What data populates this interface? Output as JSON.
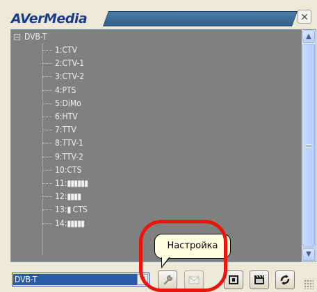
{
  "app": {
    "logo": "AVerMedia"
  },
  "titlebar": {
    "close_label": "×"
  },
  "tree": {
    "root_label": "DVB-T",
    "channels": [
      {
        "label": "1:CTV"
      },
      {
        "label": "2:CTV-1"
      },
      {
        "label": "3:CTV-2"
      },
      {
        "label": "4:PTS"
      },
      {
        "label": "5:DiMo"
      },
      {
        "label": "6:HTV"
      },
      {
        "label": "7:TTV"
      },
      {
        "label": "8:TTV-1"
      },
      {
        "label": "9:TTV-2"
      },
      {
        "label": "10:CTS"
      },
      {
        "label": "11:",
        "bars": "▮▮▮▮▮▮"
      },
      {
        "label": "12:",
        "bars": "▮▮▮▮"
      },
      {
        "label": "13:",
        "bars": "▮",
        "suffix": " CTS"
      },
      {
        "label": "14:",
        "bars": "▮▮▮▮▮"
      }
    ]
  },
  "scrollbar": {
    "up_arrow": "▲",
    "down_arrow": "▼"
  },
  "source": {
    "selected": "DVB-T",
    "dropdown_arrow": "▼"
  },
  "tooltip": {
    "text": "Настройка"
  },
  "colors": {
    "list_background": "#808080",
    "list_text": "#f0f0f0",
    "tooltip_background": "#ffffe1",
    "highlight": "#e8160c",
    "brand": "#1b3c8c"
  },
  "icons": {
    "settings": "wrench-icon",
    "message": "envelope-icon",
    "record": "record-icon",
    "clapper": "clapper-icon",
    "refresh": "refresh-icon"
  }
}
